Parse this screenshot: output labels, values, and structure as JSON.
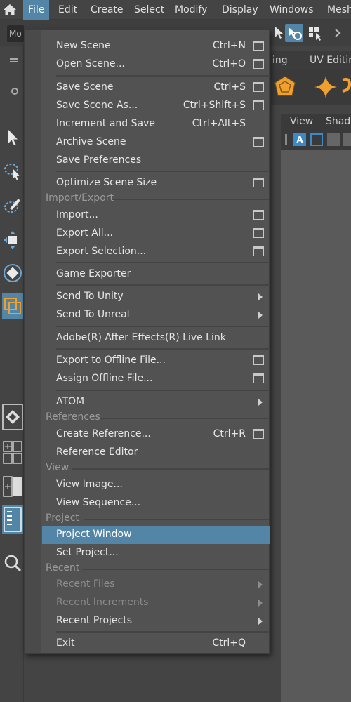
{
  "menubar": {
    "items": [
      "File",
      "Edit",
      "Create",
      "Select",
      "Modify",
      "Display",
      "Windows",
      "Mesh"
    ]
  },
  "toolbar2": {
    "mode_label": "Mo"
  },
  "shelf": {
    "tabs": [
      "ing",
      "UV Editing"
    ]
  },
  "viewport": {
    "menu": [
      "View",
      "Shad"
    ],
    "badge": "A"
  },
  "file_menu": {
    "new_scene": {
      "label": "New Scene",
      "shortcut": "Ctrl+N"
    },
    "open_scene": {
      "label": "Open Scene...",
      "shortcut": "Ctrl+O"
    },
    "save_scene": {
      "label": "Save Scene",
      "shortcut": "Ctrl+S"
    },
    "save_scene_as": {
      "label": "Save Scene As...",
      "shortcut": "Ctrl+Shift+S"
    },
    "increment_save": {
      "label": "Increment and Save",
      "shortcut": "Ctrl+Alt+S"
    },
    "archive_scene": {
      "label": "Archive Scene"
    },
    "save_prefs": {
      "label": "Save Preferences"
    },
    "optimize": {
      "label": "Optimize Scene Size"
    },
    "section_import_export": "Import/Export",
    "import": {
      "label": "Import..."
    },
    "export_all": {
      "label": "Export All..."
    },
    "export_selection": {
      "label": "Export Selection..."
    },
    "game_exporter": {
      "label": "Game Exporter"
    },
    "send_unity": {
      "label": "Send To Unity"
    },
    "send_unreal": {
      "label": "Send To Unreal"
    },
    "ae_live_link": {
      "label": "Adobe(R) After Effects(R) Live Link"
    },
    "export_offline": {
      "label": "Export to Offline File..."
    },
    "assign_offline": {
      "label": "Assign Offline File..."
    },
    "atom": {
      "label": "ATOM"
    },
    "section_references": "References",
    "create_reference": {
      "label": "Create Reference...",
      "shortcut": "Ctrl+R"
    },
    "reference_editor": {
      "label": "Reference Editor"
    },
    "section_view": "View",
    "view_image": {
      "label": "View Image..."
    },
    "view_sequence": {
      "label": "View Sequence..."
    },
    "section_project": "Project",
    "project_window": {
      "label": "Project Window"
    },
    "set_project": {
      "label": "Set Project..."
    },
    "section_recent": "Recent",
    "recent_files": {
      "label": "Recent Files"
    },
    "recent_increments": {
      "label": "Recent Increments"
    },
    "recent_projects": {
      "label": "Recent Projects"
    },
    "exit": {
      "label": "Exit",
      "shortcut": "Ctrl+Q"
    }
  },
  "colors": {
    "accent": "#5285a6",
    "menu_bg": "#525252",
    "app_bg": "#444444"
  }
}
